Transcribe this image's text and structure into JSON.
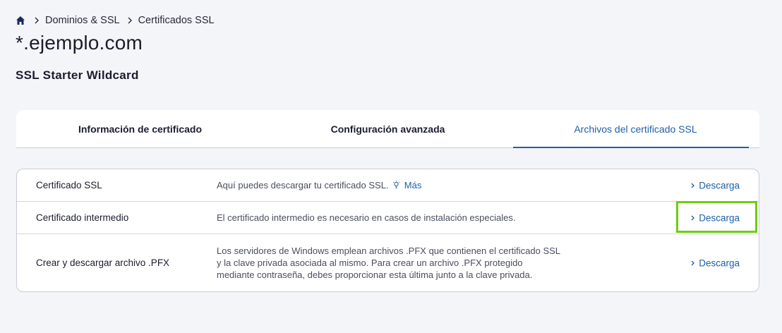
{
  "breadcrumb": {
    "home_icon": "home-icon",
    "items": [
      "Dominios & SSL",
      "Certificados SSL"
    ]
  },
  "page": {
    "title": "*.ejemplo.com",
    "subtitle": "SSL Starter Wildcard"
  },
  "tabs": [
    {
      "label": "Información de certificado",
      "active": false
    },
    {
      "label": "Configuración avanzada",
      "active": false
    },
    {
      "label": "Archivos del certificado SSL",
      "active": true
    }
  ],
  "files": [
    {
      "name": "Certificado SSL",
      "description": "Aquí puedes descargar tu certificado SSL.",
      "more_label": "Más",
      "action": "Descarga"
    },
    {
      "name": "Certificado intermedio",
      "description": "El certificado intermedio es necesario en casos de instalación especiales.",
      "action": "Descarga"
    },
    {
      "name": "Crear y descargar archivo .PFX",
      "description_lines": [
        "Los servidores de Windows emplean archivos .PFX que contienen el certificado SSL",
        "y la clave privada asociada al mismo. Para crear un archivo .PFX protegido",
        "mediante contraseña, debes proporcionar esta última junto a la clave privada."
      ],
      "action": "Descarga"
    }
  ],
  "colors": {
    "accent": "#1f5fa8",
    "highlight": "#6fcc12",
    "background": "#f4f5f8"
  }
}
